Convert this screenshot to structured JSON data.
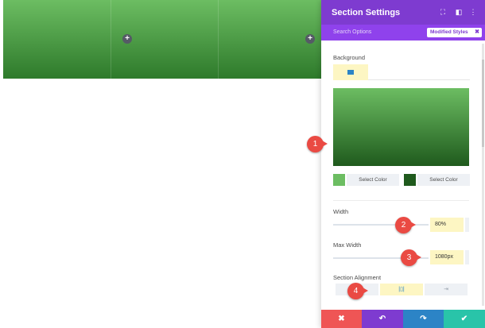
{
  "preview": {
    "add_icon_glyph": "+",
    "gradient_top": "#6cbd62",
    "gradient_bottom": "#2e7a2b"
  },
  "modal": {
    "title": "Section Settings",
    "header_icons": [
      "fullscreen-icon",
      "split-view-icon",
      "more-options-icon"
    ],
    "search_placeholder": "Search Options",
    "filter_badge": "Modified Styles",
    "filter_badge_close": "✖",
    "accent_color": "#7e3bd0"
  },
  "background": {
    "label": "Background",
    "tab_icon": "gradient-icon",
    "gradient_start": "#6cbd62",
    "gradient_end": "#1f5a1d",
    "color_stops": [
      {
        "color": "#6cbd62",
        "label": "Select Color"
      },
      {
        "color": "#1f5a1d",
        "label": "Select Color"
      }
    ]
  },
  "width": {
    "label": "Width",
    "value": "80%"
  },
  "max_width": {
    "label": "Max Width",
    "value": "1080px"
  },
  "section_alignment": {
    "label": "Section Alignment",
    "options": [
      "left-align-icon",
      "center-align-icon",
      "right-align-icon"
    ],
    "selected": "center-align-icon",
    "glyphs": [
      "",
      "|▯|",
      "⇥"
    ]
  },
  "footer": {
    "cancel_glyph": "✖",
    "undo_glyph": "↶",
    "redo_glyph": "↷",
    "save_glyph": "✔",
    "colors": [
      "#ef5555",
      "#7e3bd0",
      "#2c84c6",
      "#29c4a9"
    ]
  },
  "callouts": [
    "1",
    "2",
    "3",
    "4"
  ]
}
